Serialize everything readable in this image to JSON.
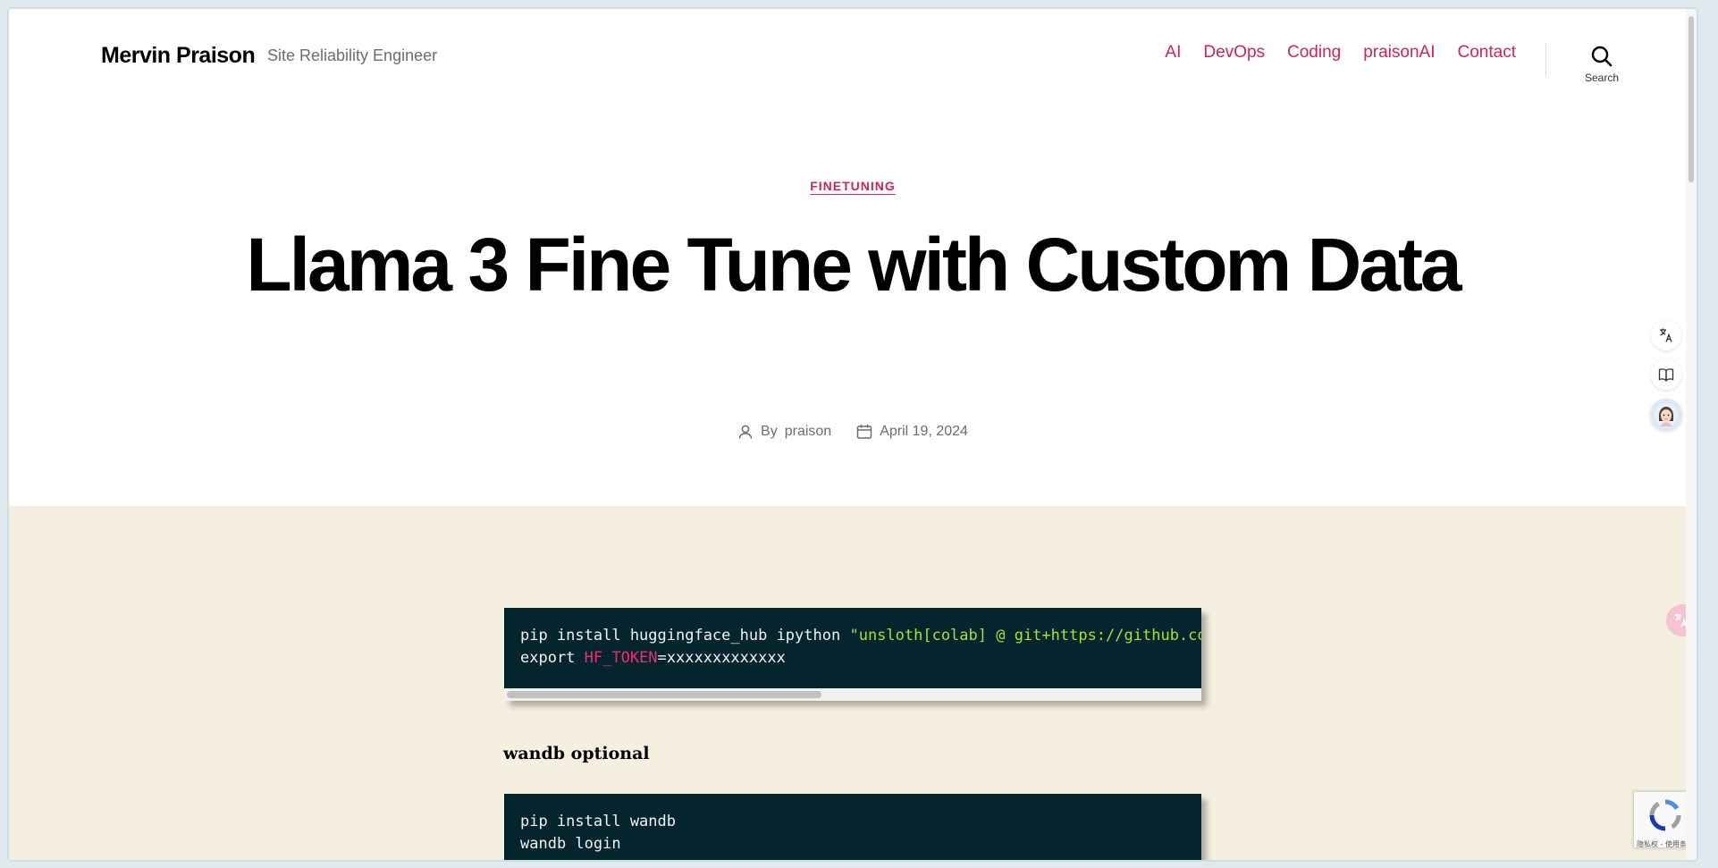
{
  "header": {
    "site_title": "Mervin Praison",
    "site_description": "Site Reliability Engineer",
    "nav": [
      "AI",
      "DevOps",
      "Coding",
      "praisonAI",
      "Contact"
    ],
    "search_label": "Search"
  },
  "post": {
    "category": "FINETUNING",
    "title": "Llama 3 Fine Tune with Custom Data",
    "author_prefix": "By",
    "author": "praison",
    "date": "April 19, 2024"
  },
  "content": {
    "code1": {
      "line1_plain": "pip install huggingface_hub ipython ",
      "line1_string": "\"unsloth[colab] @ git+https://github.co",
      "line2_cmd": "export ",
      "line2_var": "HF_TOKEN",
      "line2_value": "=xxxxxxxxxxxxx"
    },
    "section_heading": "wandb optional",
    "code2": {
      "line1": "pip install wandb",
      "line2": "wandb login"
    }
  },
  "widgets": {
    "recaptcha_text": "隐私权 - 使用条款"
  },
  "colors": {
    "accent": "#cd2653",
    "content_bg": "#f5efe0",
    "code_bg": "#04252d"
  }
}
